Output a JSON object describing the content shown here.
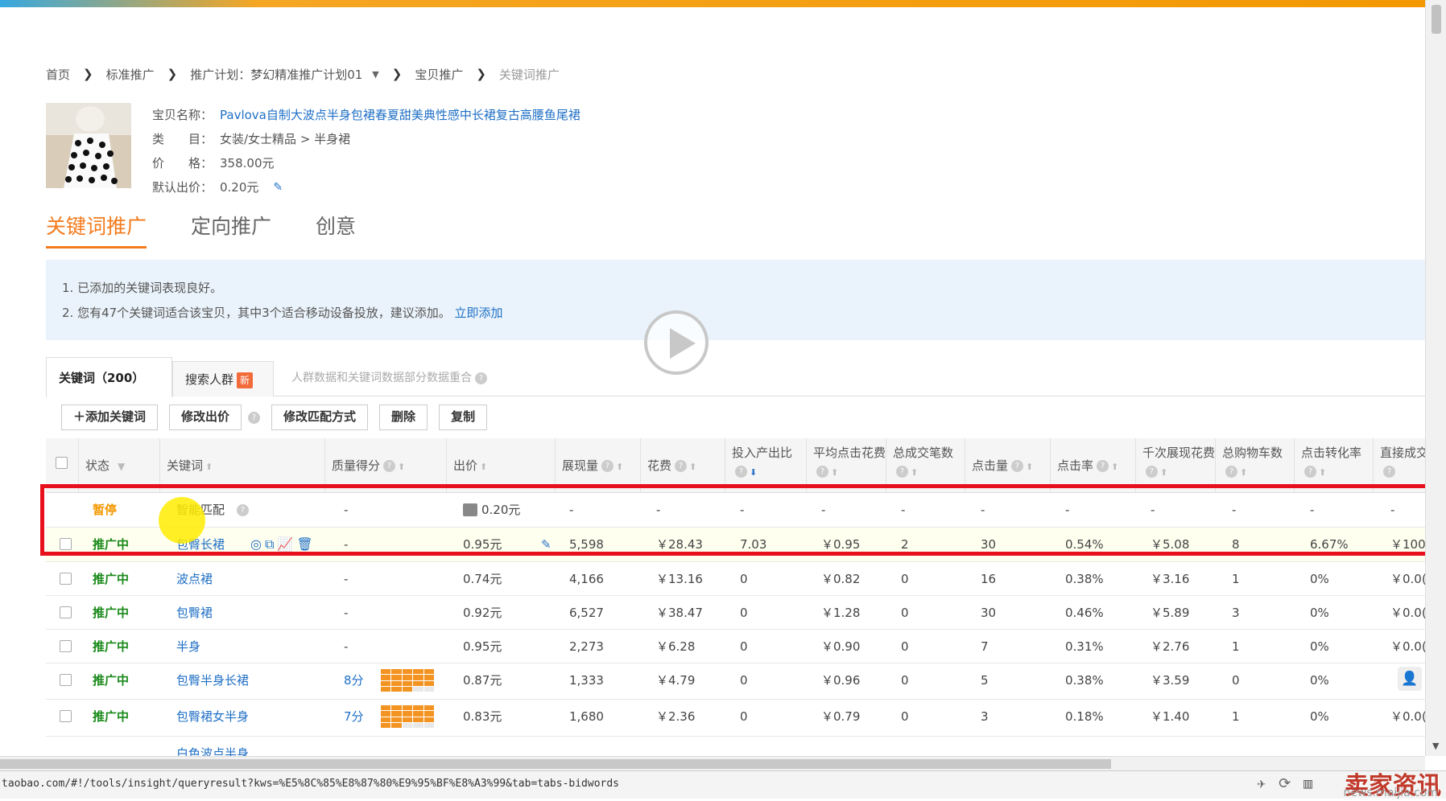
{
  "breadcrumb": {
    "items": [
      "首页",
      "标准推广",
      "推广计划：梦幻精准推广计划01",
      "宝贝推广",
      "关键词推广"
    ]
  },
  "product": {
    "name_label": "宝贝名称：",
    "name": "Pavlova自制大波点半身包裙春夏甜美典性感中长裙复古高腰鱼尾裙",
    "category_label": "类　　目：",
    "category": "女装/女士精品 > 半身裙",
    "price_label": "价　　格：",
    "price": "358.00元",
    "default_bid_label": "默认出价：",
    "default_bid": "0.20元"
  },
  "tabs": [
    "关键词推广",
    "定向推广",
    "创意"
  ],
  "notice": {
    "line1": "1. 已添加的关键词表现良好。",
    "line2": "2. 您有47个关键词适合该宝贝，其中3个适合移动设备投放，建议添加。",
    "link": "立即添加"
  },
  "subtabs": {
    "keywords": "关键词（200）",
    "crowd": "搜索人群",
    "new_badge": "新",
    "note": "人群数据和关键词数据部分数据重合"
  },
  "toolbar": {
    "add": "＋添加关键词",
    "edit_bid": "修改出价",
    "edit_match": "修改匹配方式",
    "delete": "删除",
    "copy": "复制"
  },
  "columns": [
    "状态",
    "关键词",
    "质量得分",
    "出价",
    "展现量",
    "花费",
    "投入产出比",
    "平均点击花费",
    "总成交笔数",
    "点击量",
    "点击率",
    "千次展现花费",
    "总购物车数",
    "点击转化率",
    "直接成交金额"
  ],
  "rows": [
    {
      "status": "暂停",
      "keyword": "智能匹配",
      "score": "-",
      "bid": "0.20元",
      "impr": "-",
      "cost": "-",
      "roi": "-",
      "cpc": "-",
      "deals": "-",
      "clicks": "-",
      "ctr": "-",
      "cpm": "-",
      "cart": "-",
      "cvr": "-",
      "direct": "-"
    },
    {
      "status": "推广中",
      "keyword": "包臀长裙",
      "score": "-",
      "bid": "0.95元",
      "impr": "5,598",
      "cost": "￥28.43",
      "roi": "7.03",
      "cpc": "￥0.95",
      "deals": "2",
      "clicks": "30",
      "ctr": "0.54%",
      "cpm": "￥5.08",
      "cart": "8",
      "cvr": "6.67%",
      "direct": "￥100"
    },
    {
      "status": "推广中",
      "keyword": "波点裙",
      "score": "-",
      "bid": "0.74元",
      "impr": "4,166",
      "cost": "￥13.16",
      "roi": "0",
      "cpc": "￥0.82",
      "deals": "0",
      "clicks": "16",
      "ctr": "0.38%",
      "cpm": "￥3.16",
      "cart": "1",
      "cvr": "0%",
      "direct": "￥0.0("
    },
    {
      "status": "推广中",
      "keyword": "包臀裙",
      "score": "-",
      "bid": "0.92元",
      "impr": "6,527",
      "cost": "￥38.47",
      "roi": "0",
      "cpc": "￥1.28",
      "deals": "0",
      "clicks": "30",
      "ctr": "0.46%",
      "cpm": "￥5.89",
      "cart": "3",
      "cvr": "0%",
      "direct": "￥0.0("
    },
    {
      "status": "推广中",
      "keyword": "半身",
      "score": "-",
      "bid": "0.95元",
      "impr": "2,273",
      "cost": "￥6.28",
      "roi": "0",
      "cpc": "￥0.90",
      "deals": "0",
      "clicks": "7",
      "ctr": "0.31%",
      "cpm": "￥2.76",
      "cart": "1",
      "cvr": "0%",
      "direct": "￥0.0("
    },
    {
      "status": "推广中",
      "keyword": "包臀半身长裙",
      "score": "8分",
      "bid": "0.87元",
      "impr": "1,333",
      "cost": "￥4.79",
      "roi": "0",
      "cpc": "￥0.96",
      "deals": "0",
      "clicks": "5",
      "ctr": "0.38%",
      "cpm": "￥3.59",
      "cart": "0",
      "cvr": "0%",
      "direct": ""
    },
    {
      "status": "推广中",
      "keyword": "包臀裙女半身",
      "score": "7分",
      "bid": "0.83元",
      "impr": "1,680",
      "cost": "￥2.36",
      "roi": "0",
      "cpc": "￥0.79",
      "deals": "0",
      "clicks": "3",
      "ctr": "0.18%",
      "cpm": "￥1.40",
      "cart": "1",
      "cvr": "0%",
      "direct": "￥0.0("
    },
    {
      "status": "",
      "keyword": "白色波点半身",
      "score": "",
      "bid": "",
      "impr": "",
      "cost": "",
      "roi": "",
      "cpc": "",
      "deals": "",
      "clicks": "",
      "ctr": "",
      "cpm": "",
      "cart": "",
      "cvr": "",
      "direct": ""
    }
  ],
  "statusbar": {
    "url": "taobao.com/#!/tools/insight/queryresult?kws=%E5%8C%85%E8%87%80%E9%95%BF%E8%A3%99&tab=tabs-bidwords"
  },
  "watermark": {
    "text": "卖家资讯",
    "sub": "news.maijia.com"
  },
  "colors": {
    "accent": "#f37b1d",
    "link": "#1f6fc5",
    "status_on": "#1a8a1a",
    "status_pause": "#f39800",
    "highlight": "#e8101c"
  }
}
